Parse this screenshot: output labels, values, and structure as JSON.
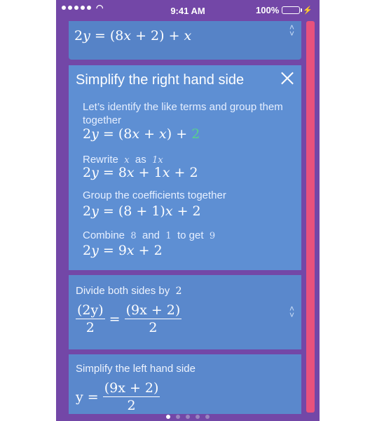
{
  "status_bar": {
    "time": "9:41 AM",
    "battery": "100%"
  },
  "prev_step": {
    "equation": "2y = (8x + 2) + x"
  },
  "active_step": {
    "title": "Simplify the right hand side",
    "steps": [
      {
        "text": "Let’s identify the like terms and group them together",
        "math": "2y = (8x + x) + 2"
      },
      {
        "text_parts": [
          "Rewrite",
          "x",
          "as",
          "1x"
        ],
        "math": "2y = 8x + 1x + 2"
      },
      {
        "text": "Group the coefficients together",
        "math": "2y = (8 + 1)x + 2"
      },
      {
        "text_parts": [
          "Combine",
          "8",
          "and",
          "1",
          "to get",
          "9"
        ],
        "math": "2y = 9x + 2"
      }
    ]
  },
  "divide_step": {
    "label": "Divide both sides by",
    "label_value": "2",
    "lhs_num": "(2y)",
    "lhs_den": "2",
    "rhs_num": "(9x + 2)",
    "rhs_den": "2"
  },
  "simplify_left_step": {
    "label": "Simplify the left hand side",
    "lhs": "y =",
    "rhs_num": "(9x + 2)",
    "rhs_den": "2"
  },
  "pager": {
    "count": 5,
    "active_index": 0
  },
  "colors": {
    "background": "#7347a7",
    "card": "#5a88cc",
    "accent": "#e8527c",
    "highlight": "#58d18b"
  }
}
